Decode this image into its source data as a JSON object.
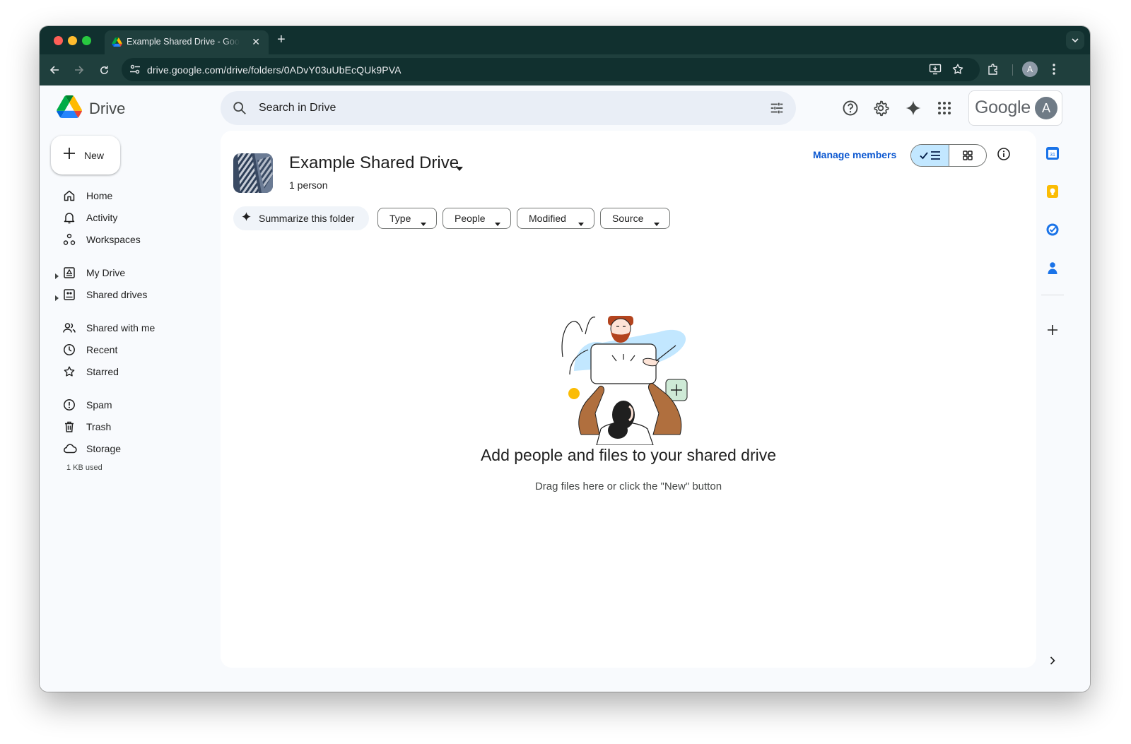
{
  "browser": {
    "tab_title": "Example Shared Drive - Google Drive",
    "url": "drive.google.com/drive/folders/0ADvY03uUbEcQUk9PVA",
    "profile_initial": "A"
  },
  "header": {
    "app_name": "Drive",
    "search_placeholder": "Search in Drive",
    "google_wordmark": "Google",
    "avatar_initial": "A"
  },
  "sidebar": {
    "new_label": "New",
    "items": [
      {
        "label": "Home",
        "icon": "home-icon"
      },
      {
        "label": "Activity",
        "icon": "bell-icon"
      },
      {
        "label": "Workspaces",
        "icon": "workspaces-icon"
      },
      {
        "label": "My Drive",
        "icon": "my-drive-icon"
      },
      {
        "label": "Shared drives",
        "icon": "shared-drives-icon"
      },
      {
        "label": "Shared with me",
        "icon": "people-icon"
      },
      {
        "label": "Recent",
        "icon": "clock-icon"
      },
      {
        "label": "Starred",
        "icon": "star-icon"
      },
      {
        "label": "Spam",
        "icon": "spam-icon"
      },
      {
        "label": "Trash",
        "icon": "trash-icon"
      },
      {
        "label": "Storage",
        "icon": "cloud-icon"
      }
    ],
    "storage_used": "1 KB used"
  },
  "main": {
    "drive_title": "Example Shared Drive",
    "people_count": "1 person",
    "manage_members": "Manage members",
    "summarize_label": "Summarize this folder",
    "filters": [
      "Type",
      "People",
      "Modified",
      "Source"
    ],
    "empty_title": "Add people and files to your shared drive",
    "empty_subtitle": "Drag files here or click the \"New\" button",
    "view_mode": "list"
  },
  "colors": {
    "accent_blue": "#0b57d0",
    "view_toggle_selected": "#c2e7ff",
    "search_bg": "#e9eef6",
    "chrome_frame": "#11302f"
  }
}
